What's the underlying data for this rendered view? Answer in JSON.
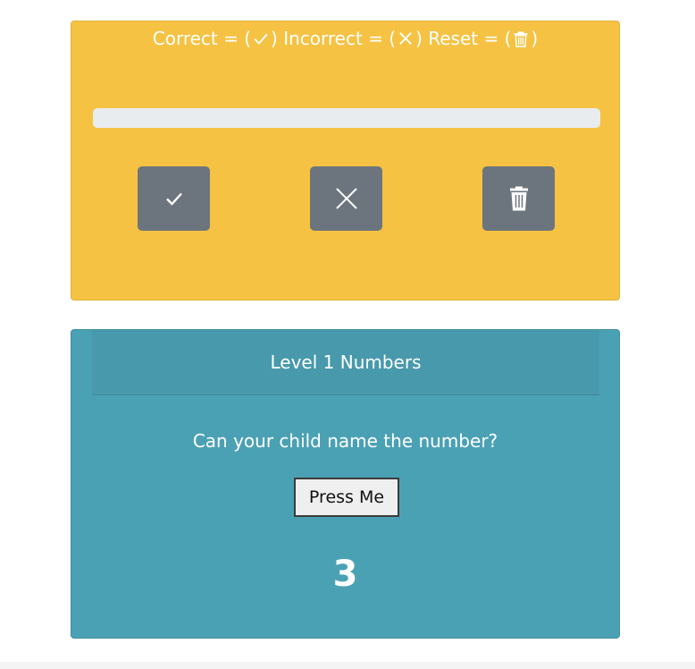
{
  "legend": {
    "correct_label": "Correct = (",
    "incorrect_label": ") Incorrect = (",
    "reset_label": ") Reset = (",
    "end_paren": ")"
  },
  "progress": {
    "value": 0
  },
  "buttons": {
    "correct_icon": "check-icon",
    "incorrect_icon": "x-icon",
    "reset_icon": "trash-icon"
  },
  "level": {
    "title": "Level 1 Numbers",
    "question": "Can your child name the number?",
    "press_label": "Press Me",
    "number": "3"
  },
  "colors": {
    "score_card": "#f5c243",
    "level_card": "#4ba1b4",
    "button": "#6c757d",
    "progress_track": "#e9ecef"
  }
}
